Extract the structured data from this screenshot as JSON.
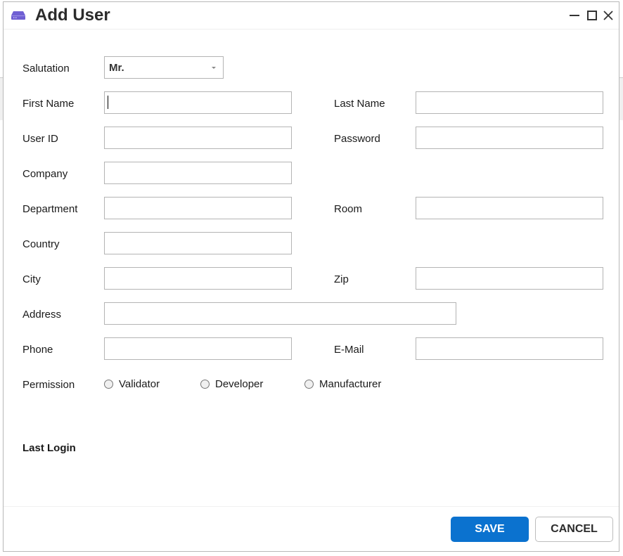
{
  "window": {
    "title": "Add User",
    "icon": "drive-icon",
    "controls": [
      "minimize",
      "maximize",
      "close"
    ]
  },
  "form": {
    "salutation": {
      "label": "Salutation",
      "value": "Mr."
    },
    "first_name": {
      "label": "First Name",
      "value": ""
    },
    "last_name": {
      "label": "Last Name",
      "value": ""
    },
    "user_id": {
      "label": "User ID",
      "value": ""
    },
    "password": {
      "label": "Password",
      "value": ""
    },
    "company": {
      "label": "Company",
      "value": ""
    },
    "department": {
      "label": "Department",
      "value": ""
    },
    "room": {
      "label": "Room",
      "value": ""
    },
    "country": {
      "label": "Country",
      "value": ""
    },
    "city": {
      "label": "City",
      "value": ""
    },
    "zip": {
      "label": "Zip",
      "value": ""
    },
    "address": {
      "label": "Address",
      "value": ""
    },
    "phone": {
      "label": "Phone",
      "value": ""
    },
    "email": {
      "label": "E-Mail",
      "value": ""
    },
    "permission": {
      "label": "Permission",
      "options": [
        "Validator",
        "Developer",
        "Manufacturer"
      ],
      "selected": null
    },
    "last_login": {
      "label": "Last Login"
    }
  },
  "footer": {
    "save_label": "SAVE",
    "cancel_label": "CANCEL"
  },
  "colors": {
    "accent": "#0b72cf",
    "icon": "#6f5fd3"
  }
}
